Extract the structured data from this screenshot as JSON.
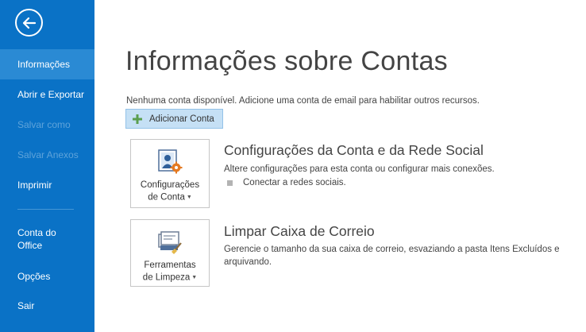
{
  "sidebar": {
    "back_icon": "back-arrow-icon",
    "items": [
      {
        "label": "Informações",
        "state": "active"
      },
      {
        "label": "Abrir e Exportar",
        "state": "enabled"
      },
      {
        "label": "Salvar como",
        "state": "disabled"
      },
      {
        "label": "Salvar Anexos",
        "state": "disabled"
      },
      {
        "label": "Imprimir",
        "state": "enabled"
      },
      {
        "label": "Conta do Office",
        "state": "enabled"
      },
      {
        "label": "Opções",
        "state": "enabled"
      },
      {
        "label": "Sair",
        "state": "enabled"
      }
    ]
  },
  "main": {
    "title": "Informações sobre Contas",
    "no_account_text": "Nenhuma conta disponível. Adicione uma conta de email para habilitar outros recursos.",
    "add_account_label": "Adicionar Conta",
    "sections": [
      {
        "tile_line1": "Configurações",
        "tile_line2": "de Conta",
        "tile_icon": "account-settings-icon",
        "title": "Configurações da Conta e da Rede Social",
        "description": "Altere configurações para esta conta ou configurar mais conexões.",
        "link": "Conectar a redes sociais."
      },
      {
        "tile_line1": "Ferramentas",
        "tile_line2": "de Limpeza",
        "tile_icon": "cleanup-tools-icon",
        "title": "Limpar Caixa de Correio",
        "description": "Gerencie o tamanho da sua caixa de correio, esvaziando a pasta Itens Excluídos e arquivando."
      }
    ]
  },
  "colors": {
    "sidebar_bg": "#0a72c6",
    "sidebar_active": "#2a8ad4",
    "sidebar_disabled_text": "#5ea3da",
    "add_button_bg": "#c5e0f5",
    "plus_green": "#5a9e4e",
    "accent_orange": "#e47a22"
  }
}
